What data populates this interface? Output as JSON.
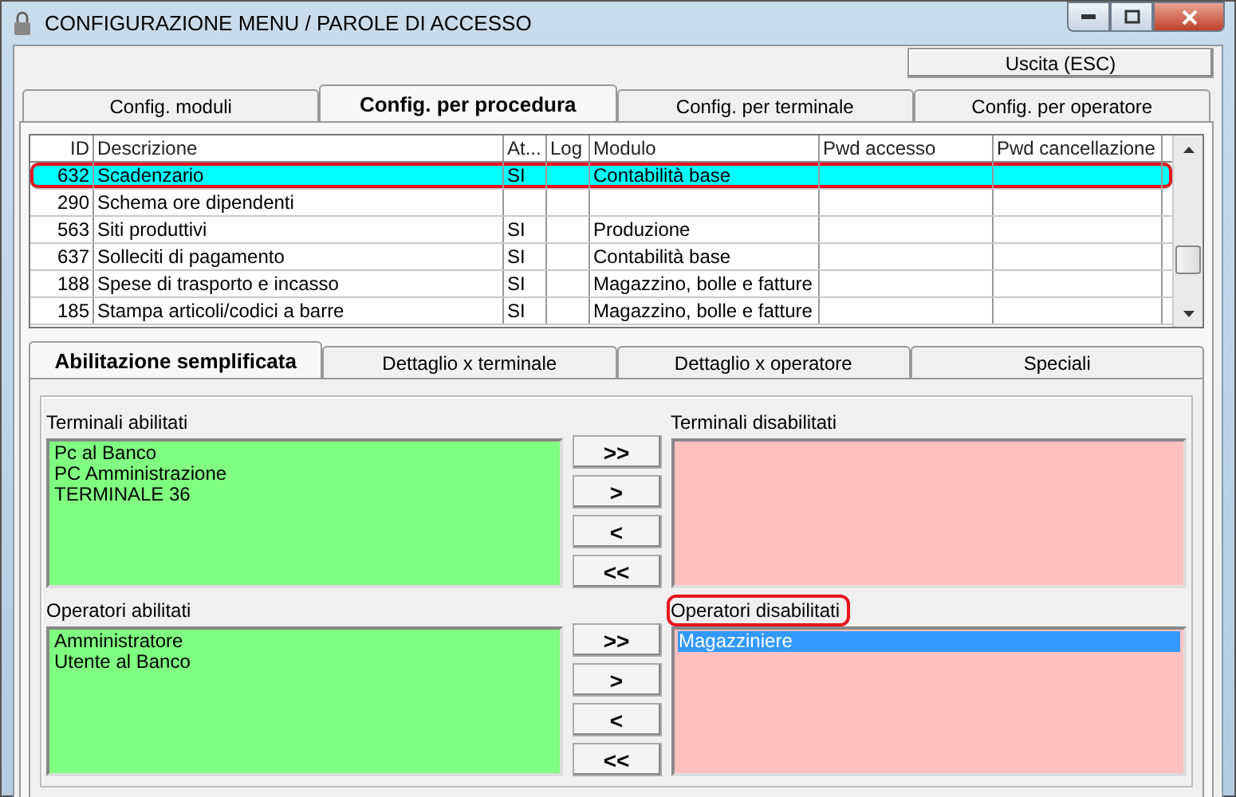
{
  "window": {
    "title": "CONFIGURAZIONE MENU / PAROLE DI ACCESSO"
  },
  "exit_button": "Uscita (ESC)",
  "tabs": [
    {
      "label": "Config. moduli",
      "selected": false
    },
    {
      "label": "Config. per procedura",
      "selected": true
    },
    {
      "label": "Config. per terminale",
      "selected": false
    },
    {
      "label": "Config. per operatore",
      "selected": false
    }
  ],
  "table": {
    "columns": [
      "ID",
      "Descrizione",
      "At...",
      "Log",
      "Modulo",
      "Pwd accesso",
      "Pwd cancellazione"
    ],
    "rows": [
      {
        "cells": [
          "632",
          "Scadenzario",
          "SI",
          "",
          "Contabilità base",
          "",
          ""
        ],
        "selected": true,
        "annotated": true
      },
      {
        "cells": [
          "290",
          "Schema ore dipendenti",
          "",
          "",
          "",
          "",
          ""
        ],
        "selected": false,
        "annotated": false
      },
      {
        "cells": [
          "563",
          "Siti produttivi",
          "SI",
          "",
          "Produzione",
          "",
          ""
        ],
        "selected": false,
        "annotated": false
      },
      {
        "cells": [
          "637",
          "Solleciti di pagamento",
          "SI",
          "",
          "Contabilità base",
          "",
          ""
        ],
        "selected": false,
        "annotated": false
      },
      {
        "cells": [
          "188",
          "Spese di trasporto e incasso",
          "SI",
          "",
          "Magazzino, bolle e fatture",
          "",
          ""
        ],
        "selected": false,
        "annotated": false
      },
      {
        "cells": [
          "185",
          "Stampa articoli/codici a barre",
          "SI",
          "",
          "Magazzino, bolle e fatture",
          "",
          ""
        ],
        "selected": false,
        "annotated": false
      }
    ]
  },
  "sub_tabs": [
    {
      "label": "Abilitazione semplificata",
      "selected": true
    },
    {
      "label": "Dettaglio x terminale",
      "selected": false
    },
    {
      "label": "Dettaglio x operatore",
      "selected": false
    },
    {
      "label": "Speciali",
      "selected": false
    }
  ],
  "sections": [
    {
      "enabled": {
        "label": "Terminali abilitati",
        "items": [
          {
            "text": "Pc al Banco",
            "selected": false
          },
          {
            "text": "PC Amministrazione",
            "selected": false
          },
          {
            "text": "TERMINALE 36",
            "selected": false
          }
        ]
      },
      "disabled": {
        "label": "Terminali disabilitati",
        "annotated": false
      },
      "buttons": [
        ">>",
        ">",
        "<",
        "<<"
      ]
    },
    {
      "enabled": {
        "label": "Operatori abilitati",
        "items": [
          {
            "text": "Amministratore",
            "selected": false
          },
          {
            "text": "Utente al Banco",
            "selected": false
          }
        ]
      },
      "disabled": {
        "label": "Operatori disabilitati",
        "annotated": true,
        "items": [
          {
            "text": "Magazziniere",
            "selected": true
          }
        ]
      },
      "buttons": [
        ">>",
        ">",
        "<",
        "<<"
      ]
    }
  ]
}
